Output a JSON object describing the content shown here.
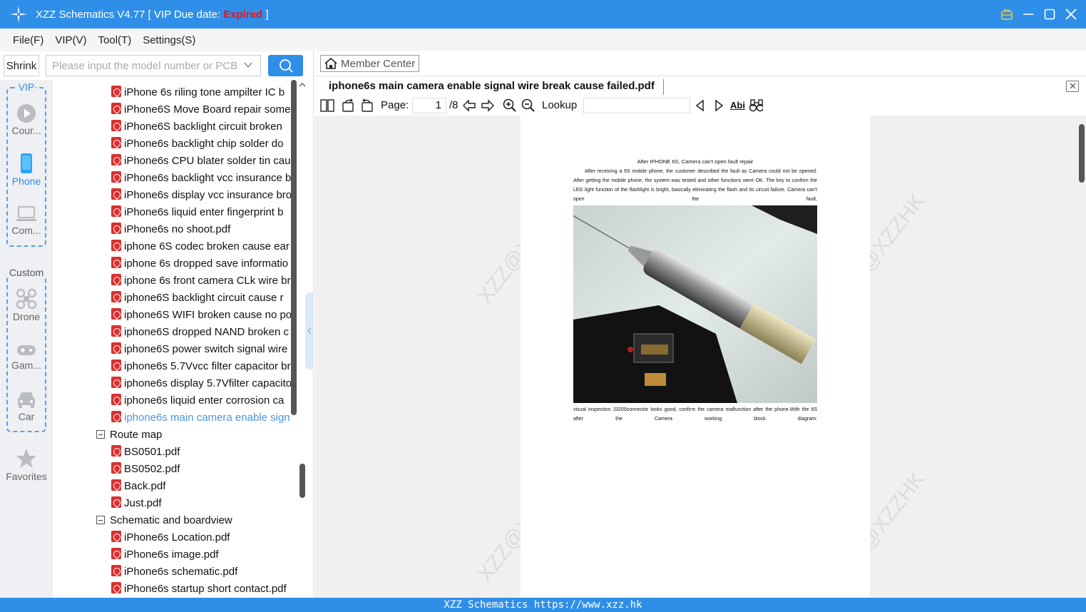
{
  "titlebar": {
    "title_prefix": "XZZ Schematics V4.77 [ VIP Due date: ",
    "expired": "Expired",
    "title_suffix": " ]"
  },
  "menu": [
    "File(F)",
    "VIP(V)",
    "Tool(T)",
    "Settings(S)"
  ],
  "left": {
    "shrink_label": "Shrink",
    "search_placeholder": "Please input the model number or PCB"
  },
  "sidebar": {
    "vip_label": "VIP",
    "custom_label": "Custom",
    "vip_items": [
      {
        "label": "Cour...",
        "icon": "play-icon"
      },
      {
        "label": "Phone",
        "icon": "phone-icon"
      },
      {
        "label": "Com...",
        "icon": "laptop-icon"
      }
    ],
    "custom_items": [
      {
        "label": "Drone",
        "icon": "drone-icon"
      },
      {
        "label": "Gam...",
        "icon": "gamepad-icon"
      },
      {
        "label": "Car",
        "icon": "car-icon"
      }
    ],
    "favorites_label": "Favorites"
  },
  "tree": {
    "files_a": [
      "iPhone 6s riling tone ampilter IC b",
      "iPhone6S Move Board repair some",
      "iPhone6S backlight circuit broken",
      "iPhone6s  backlight chip solder do",
      "iPhone6s CPU blater solder tin cau",
      "iPhone6s backlight vcc insurance b",
      "iPhone6s display vcc insurance bro",
      "iPhone6s liquid enter fingerprint b",
      "iPhone6s no shoot.pdf",
      "iphone 6S codec broken cause ear",
      "iphone 6s dropped save informatio",
      "iphone 6s front camera CLk wire br",
      "iphone6S  backlight circuit cause r",
      "iphone6S WIFI broken cause no po",
      "iphone6S dropped NAND broken c",
      "iphone6S power switch signal wire",
      "iphone6s 5.7Vvcc filter capacitor br",
      "iphone6s display 5.7Vfilter capacito",
      "iphone6s liquid enter corrosion ca",
      "iphone6s main camera enable sign"
    ],
    "folder_route": "Route map",
    "files_route": [
      "BS0501.pdf",
      "BS0502.pdf",
      "Back.pdf",
      "Just.pdf"
    ],
    "folder_schematic": "Schematic and boardview",
    "files_schematic": [
      "iPhone6s Location.pdf",
      "iPhone6s image.pdf",
      "iPhone6s schematic.pdf",
      "iPhone6s startup short contact.pdf"
    ]
  },
  "viewer": {
    "member_center": "Member Center",
    "tab_title": "iphone6s main camera enable signal wire break  cause failed.pdf",
    "page_label": "Page:",
    "page_current": "1",
    "page_total": "/8",
    "lookup_label": "Lookup",
    "abi_label": "Abi",
    "doc_title": "After IPHONE 6S, Camera can't open fault repair",
    "doc_para1": "After receiving a 6S mobile phone, the customer described the fault as Camera could not be opened. After getting the mobile phone, the system was tested and other functions were OK. The key to confirm the LED light function of the flashlight is bright, basically eliminating the flash and its circuit failure. Camera can't open the fault,",
    "doc_para2": "visual inspection J3200connector looks good, confirm the camera malfunction after the phone.With the 6S after the Camera working block diagram:",
    "watermark": "XZZ@XZZHK"
  },
  "status": "XZZ Schematics https://www.xzz.hk",
  "colors": {
    "accent": "#2f8fe8",
    "expired": "#e8141e",
    "selected": "#4a94e0"
  }
}
